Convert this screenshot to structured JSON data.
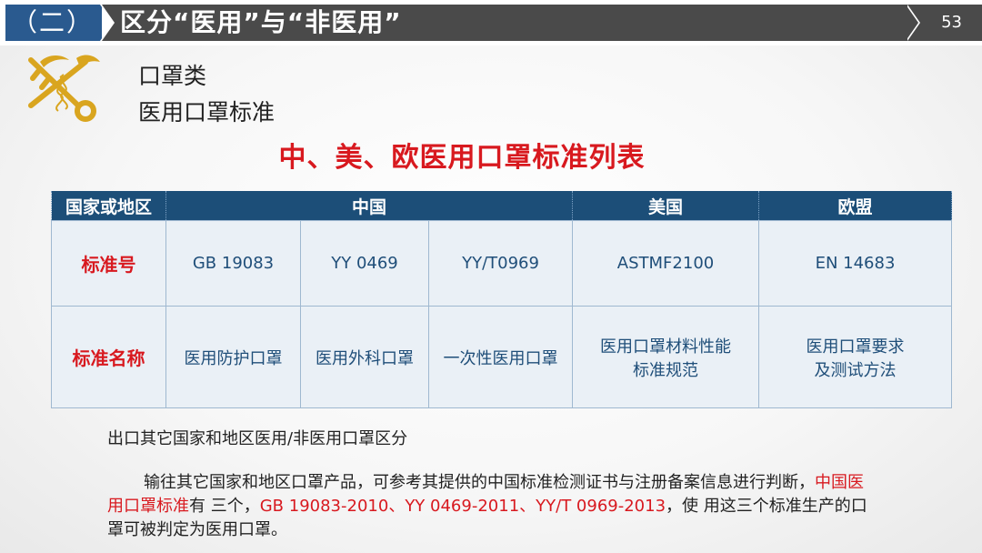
{
  "header": {
    "section_label": "（二）",
    "title": "区分“医用”与“非医用”",
    "page_number": "53"
  },
  "subtitles": {
    "line1": "口罩类",
    "line2": "医用口罩标准"
  },
  "table_title": "中、美、欧医用口罩标准列表",
  "table": {
    "headers": [
      "国家或地区",
      "中国",
      "美国",
      "欧盟"
    ],
    "rows": [
      {
        "label": "标准号",
        "cells": [
          "GB 19083",
          "YY 0469",
          "YY/T0969",
          "ASTMF2100",
          "EN 14683"
        ]
      },
      {
        "label": "标准名称",
        "cells": [
          "医用防护口罩",
          "医用外科口罩",
          "一次性医用口罩",
          "医用口罩材料性能",
          "标准规范",
          "医用口罩要求",
          "及测试方法"
        ]
      }
    ]
  },
  "notes": {
    "heading": "出口其它国家和地区医用/非医用口罩区分",
    "para_part1": "输往其它国家和地区口罩产品，可参考其提供的中国标准检测证书与注册备案信息进行判断，",
    "para_red1": "中国医用口罩标准",
    "para_part2": "有 三个，",
    "para_red2": "GB 19083-2010、YY 0469-2011、YY/T 0969-2013",
    "para_part3": "，使 用这三个标准生产的口罩可被判定为医用口罩。"
  },
  "colors": {
    "section_blue": "#2a5a8f",
    "title_gray": "#4a4a4a",
    "table_header": "#1c4e78",
    "accent_red": "#d8191f",
    "logo_gold": "#d9a51f"
  }
}
